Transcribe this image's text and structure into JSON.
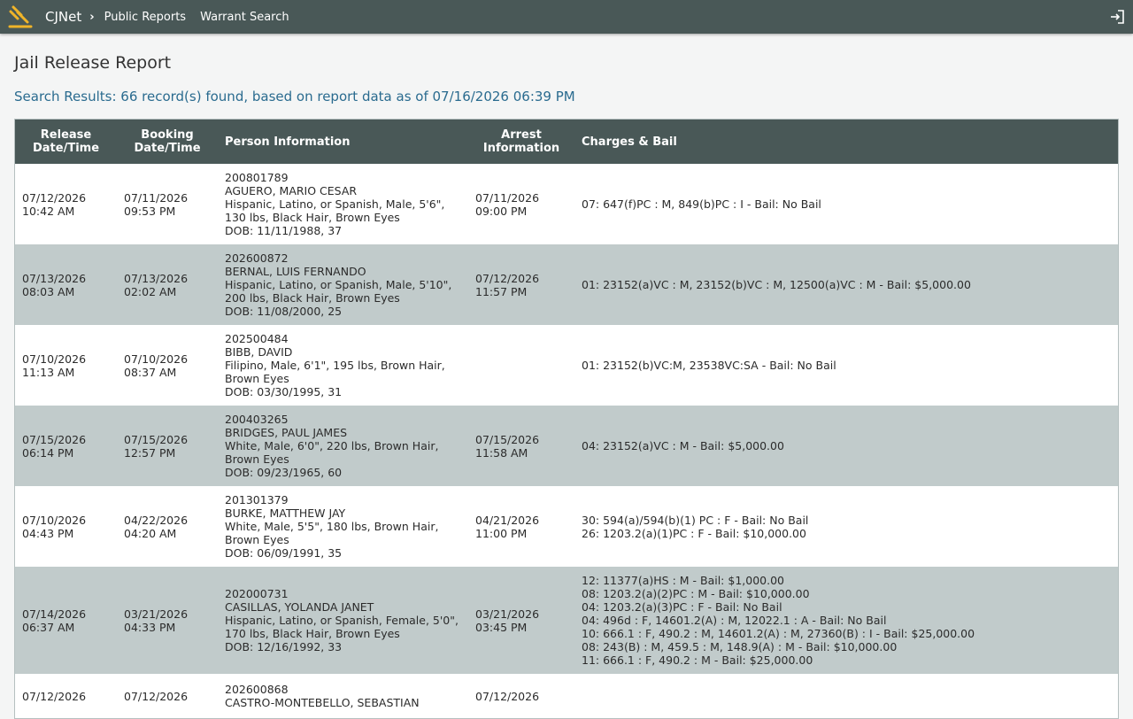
{
  "header": {
    "brand": "CJNet",
    "nav": [
      "Public Reports",
      "Warrant Search"
    ]
  },
  "page": {
    "title": "Jail Release Report",
    "results": "Search Results: 66 record(s) found, based on report data as of 07/16/2026 06:39 PM"
  },
  "table": {
    "headers": {
      "release": [
        "Release",
        "Date/Time"
      ],
      "booking": [
        "Booking",
        "Date/Time"
      ],
      "person": "Person Information",
      "arrest": [
        "Arrest",
        "Information"
      ],
      "charges": "Charges & Bail"
    },
    "rows": [
      {
        "release": [
          "07/12/2026",
          "10:42 AM"
        ],
        "booking": [
          "07/11/2026",
          "09:53 PM"
        ],
        "person": [
          "200801789",
          "AGUERO, MARIO CESAR",
          "Hispanic, Latino, or Spanish, Male, 5'6\",",
          "130 lbs, Black Hair, Brown Eyes",
          "DOB: 11/11/1988, 37"
        ],
        "arrest": [
          "07/11/2026",
          "09:00 PM"
        ],
        "charges": [
          "07: 647(f)PC : M, 849(b)PC : I - Bail: No Bail"
        ]
      },
      {
        "release": [
          "07/13/2026",
          "08:03 AM"
        ],
        "booking": [
          "07/13/2026",
          "02:02 AM"
        ],
        "person": [
          "202600872",
          "BERNAL, LUIS FERNANDO",
          "Hispanic, Latino, or Spanish, Male, 5'10\",",
          "200 lbs, Black Hair, Brown Eyes",
          "DOB: 11/08/2000, 25"
        ],
        "arrest": [
          "07/12/2026",
          "11:57 PM"
        ],
        "charges": [
          "01: 23152(a)VC : M, 23152(b)VC : M, 12500(a)VC : M - Bail: $5,000.00"
        ]
      },
      {
        "release": [
          "07/10/2026",
          "11:13 AM"
        ],
        "booking": [
          "07/10/2026",
          "08:37 AM"
        ],
        "person": [
          "202500484",
          "BIBB, DAVID",
          "Filipino, Male, 6'1\", 195 lbs, Brown Hair,",
          "Brown Eyes",
          "DOB: 03/30/1995, 31"
        ],
        "arrest": [],
        "charges": [
          "01: 23152(b)VC:M, 23538VC:SA - Bail: No Bail"
        ]
      },
      {
        "release": [
          "07/15/2026",
          "06:14 PM"
        ],
        "booking": [
          "07/15/2026",
          "12:57 PM"
        ],
        "person": [
          "200403265",
          "BRIDGES, PAUL JAMES",
          "White, Male, 6'0\", 220 lbs, Brown Hair,",
          "Brown Eyes",
          "DOB: 09/23/1965, 60"
        ],
        "arrest": [
          "07/15/2026",
          "11:58 AM"
        ],
        "charges": [
          "04: 23152(a)VC : M - Bail: $5,000.00"
        ]
      },
      {
        "release": [
          "07/10/2026",
          "04:43 PM"
        ],
        "booking": [
          "04/22/2026",
          "04:20 AM"
        ],
        "person": [
          "201301379",
          "BURKE, MATTHEW JAY",
          "White, Male, 5'5\", 180 lbs, Brown Hair,",
          "Brown Eyes",
          "DOB: 06/09/1991, 35"
        ],
        "arrest": [
          "04/21/2026",
          "11:00 PM"
        ],
        "charges": [
          "30: 594(a)/594(b)(1) PC : F - Bail: No Bail",
          "26: 1203.2(a)(1)PC : F - Bail: $10,000.00"
        ]
      },
      {
        "release": [
          "07/14/2026",
          "06:37 AM"
        ],
        "booking": [
          "03/21/2026",
          "04:33 PM"
        ],
        "person": [
          "202000731",
          "CASILLAS, YOLANDA JANET",
          "Hispanic, Latino, or Spanish, Female, 5'0\",",
          "170 lbs, Black Hair, Brown Eyes",
          "DOB: 12/16/1992, 33"
        ],
        "arrest": [
          "03/21/2026",
          "03:45 PM"
        ],
        "charges": [
          "12: 11377(a)HS : M - Bail: $1,000.00",
          "08: 1203.2(a)(2)PC : M - Bail: $10,000.00",
          "04: 1203.2(a)(3)PC : F - Bail: No Bail",
          "04: 496d : F, 14601.2(A) : M, 12022.1 : A - Bail: No Bail",
          "10: 666.1 : F, 490.2 : M, 14601.2(A) : M, 27360(B) : I - Bail: $25,000.00",
          "08: 243(B) : M, 459.5 : M, 148.9(A) : M - Bail: $10,000.00",
          "11: 666.1 : F, 490.2 : M - Bail: $25,000.00"
        ]
      },
      {
        "release": [
          "07/12/2026",
          ""
        ],
        "booking": [
          "07/12/2026",
          ""
        ],
        "person": [
          "202600868",
          "CASTRO-MONTEBELLO, SEBASTIAN"
        ],
        "arrest": [
          "07/12/2026",
          ""
        ],
        "charges": []
      }
    ]
  }
}
